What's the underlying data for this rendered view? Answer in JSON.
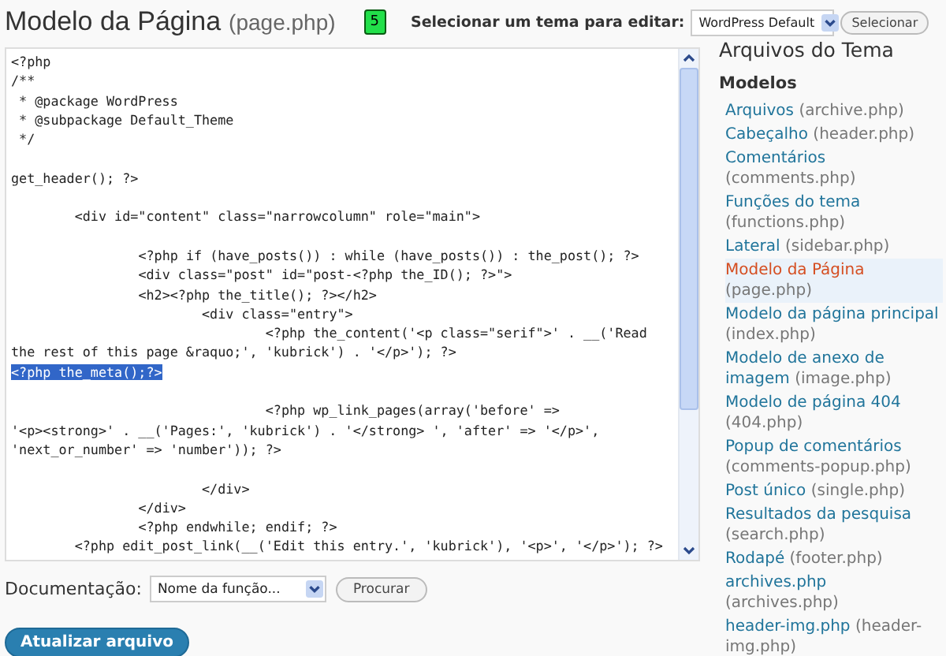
{
  "header": {
    "title": "Modelo da Página",
    "file": "(page.php)",
    "badge": "5",
    "theme_label": "Selecionar um tema para editar:",
    "theme_select": "WordPress Default",
    "select_button": "Selecionar"
  },
  "editor": {
    "lines": [
      {
        "kind": "code",
        "text": "<?php",
        "selected": false
      },
      {
        "kind": "code",
        "text": "/**",
        "selected": false
      },
      {
        "kind": "code",
        "text": " * @package WordPress",
        "selected": false
      },
      {
        "kind": "code",
        "text": " * @subpackage Default_Theme",
        "selected": false
      },
      {
        "kind": "code",
        "text": " */",
        "selected": false
      },
      {
        "kind": "blank"
      },
      {
        "kind": "code",
        "text": "get_header(); ?>",
        "selected": false
      },
      {
        "kind": "blank"
      },
      {
        "kind": "code",
        "text": "\t<div id=\"content\" class=\"narrowcolumn\" role=\"main\">",
        "selected": false
      },
      {
        "kind": "blank"
      },
      {
        "kind": "code",
        "text": "\t\t<?php if (have_posts()) : while (have_posts()) : the_post(); ?>",
        "selected": false
      },
      {
        "kind": "code",
        "text": "\t\t<div class=\"post\" id=\"post-<?php the_ID(); ?>\">",
        "selected": false
      },
      {
        "kind": "code",
        "text": "\t\t<h2><?php the_title(); ?></h2>",
        "selected": false
      },
      {
        "kind": "code",
        "text": "\t\t\t<div class=\"entry\">",
        "selected": false
      },
      {
        "kind": "code",
        "text": "\t\t\t\t<?php the_content('<p class=\"serif\">' . __('Read",
        "selected": false
      },
      {
        "kind": "code",
        "text": "the rest of this page &raquo;', 'kubrick') . '</p>'); ?>",
        "selected": false
      },
      {
        "kind": "code",
        "text": "<?php the_meta();?>",
        "selected": true
      },
      {
        "kind": "blank"
      },
      {
        "kind": "code",
        "text": "\t\t\t\t<?php wp_link_pages(array('before' =>",
        "selected": false
      },
      {
        "kind": "code",
        "text": "'<p><strong>' . __('Pages:', 'kubrick') . '</strong> ', 'after' => '</p>',",
        "selected": false
      },
      {
        "kind": "code",
        "text": "'next_or_number' => 'number')); ?>",
        "selected": false
      },
      {
        "kind": "blank"
      },
      {
        "kind": "code",
        "text": "\t\t\t</div>",
        "selected": false
      },
      {
        "kind": "code",
        "text": "\t\t</div>",
        "selected": false
      },
      {
        "kind": "code",
        "text": "\t\t<?php endwhile; endif; ?>",
        "selected": false
      },
      {
        "kind": "code",
        "text": "\t<?php edit_post_link(__('Edit this entry.', 'kubrick'), '<p>', '</p>'); ?>",
        "selected": false
      }
    ]
  },
  "documentation": {
    "label": "Documentação:",
    "select": "Nome da função...",
    "button": "Procurar"
  },
  "update_button": "Atualizar arquivo",
  "sidebar": {
    "title": "Arquivos do Tema",
    "section": "Modelos",
    "items": [
      {
        "name": "Arquivos",
        "file": "(archive.php)",
        "selected": false
      },
      {
        "name": "Cabeçalho",
        "file": "(header.php)",
        "selected": false
      },
      {
        "name": "Comentários",
        "file": "(comments.php)",
        "selected": false
      },
      {
        "name": "Funções do tema",
        "file": "(functions.php)",
        "selected": false
      },
      {
        "name": "Lateral",
        "file": "(sidebar.php)",
        "selected": false
      },
      {
        "name": "Modelo da Página",
        "file": "(page.php)",
        "selected": true
      },
      {
        "name": "Modelo da página principal",
        "file": "(index.php)",
        "selected": false
      },
      {
        "name": "Modelo de anexo de imagem",
        "file": "(image.php)",
        "selected": false
      },
      {
        "name": "Modelo de página 404",
        "file": "(404.php)",
        "selected": false
      },
      {
        "name": "Popup de comentários",
        "file": "(comments-popup.php)",
        "selected": false
      },
      {
        "name": "Post único",
        "file": "(single.php)",
        "selected": false
      },
      {
        "name": "Resultados da pesquisa",
        "file": "(search.php)",
        "selected": false
      },
      {
        "name": "Rodapé",
        "file": "(footer.php)",
        "selected": false
      },
      {
        "name": "archives.php",
        "file": "(archives.php)",
        "selected": false
      },
      {
        "name": "header-img.php",
        "file": "(header-img.php)",
        "selected": false
      }
    ]
  }
}
